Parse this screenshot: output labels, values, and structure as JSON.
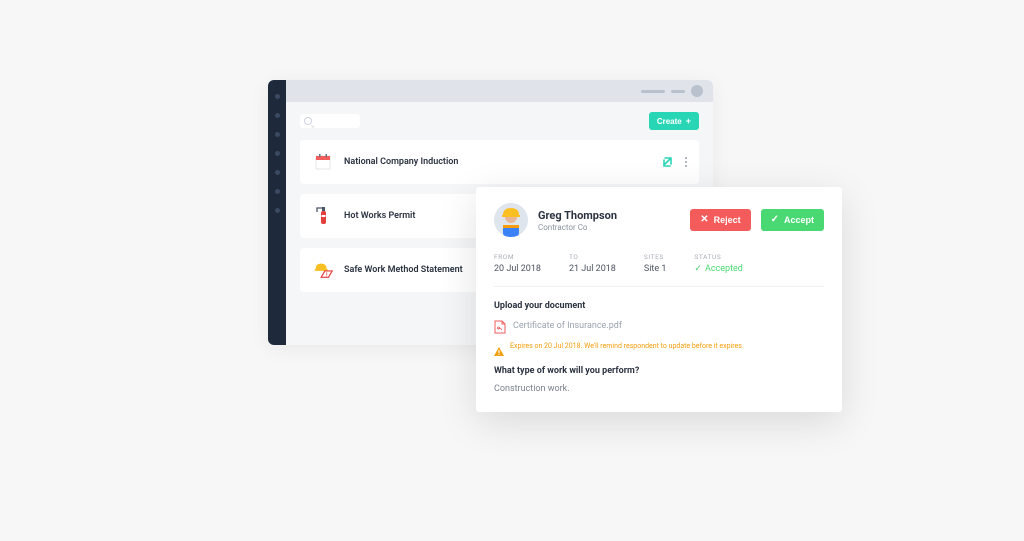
{
  "toolbar": {
    "create_label": "Create"
  },
  "list": [
    {
      "label": "National Company Induction"
    },
    {
      "label": "Hot Works Permit"
    },
    {
      "label": "Safe Work Method Statement"
    }
  ],
  "detail": {
    "name": "Greg Thompson",
    "company": "Contractor Co",
    "reject_label": "Reject",
    "accept_label": "Accept",
    "meta": {
      "from_label": "FROM",
      "from_value": "20 Jul 2018",
      "to_label": "TO",
      "to_value": "21 Jul 2018",
      "sites_label": "SITES",
      "sites_value": "Site 1",
      "status_label": "STATUS",
      "status_value": "Accepted"
    },
    "upload": {
      "title": "Upload your document",
      "file": "Certificate of Insurance.pdf",
      "expiry": "Expires on 20 Jul 2018. We'll remind respondent to update before it expires."
    },
    "question": {
      "title": "What type of work will you perform?",
      "answer": "Construction work."
    }
  }
}
